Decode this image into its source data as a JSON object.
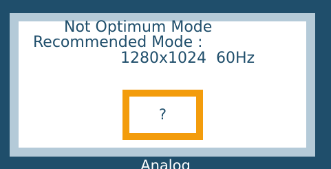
{
  "osd": {
    "message": {
      "line1": "Not Optimum Mode",
      "line2": "Recommended Mode :",
      "line3": "1280x1024  60Hz"
    },
    "help_button": {
      "label": "?",
      "highlight_color": "#f39c0c"
    },
    "source_label": "Analog",
    "colors": {
      "frame": "#1f4e6b",
      "border": "#b4cad8",
      "panel": "#ffffff",
      "text": "#1f4e6b"
    }
  }
}
